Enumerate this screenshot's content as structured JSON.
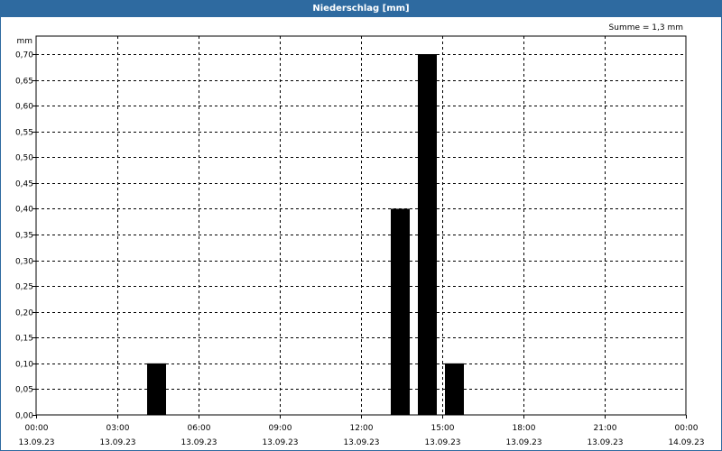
{
  "header": {
    "title": "Niederschlag [mm]"
  },
  "summary": {
    "sum_label": "Summe = 1,3 mm"
  },
  "chart_data": {
    "type": "bar",
    "title": "Niederschlag [mm]",
    "ylabel": "mm",
    "ylim": [
      0,
      0.7
    ],
    "yticks": [
      "0,00",
      "0,05",
      "0,10",
      "0,15",
      "0,20",
      "0,25",
      "0,30",
      "0,35",
      "0,40",
      "0,45",
      "0,50",
      "0,55",
      "0,60",
      "0,65",
      "0,70"
    ],
    "xlim_hours": [
      0,
      24
    ],
    "xticks": [
      {
        "time": "00:00",
        "date": "13.09.23"
      },
      {
        "time": "03:00",
        "date": "13.09.23"
      },
      {
        "time": "06:00",
        "date": "13.09.23"
      },
      {
        "time": "09:00",
        "date": "13.09.23"
      },
      {
        "time": "12:00",
        "date": "13.09.23"
      },
      {
        "time": "15:00",
        "date": "13.09.23"
      },
      {
        "time": "18:00",
        "date": "13.09.23"
      },
      {
        "time": "21:00",
        "date": "13.09.23"
      },
      {
        "time": "00:00",
        "date": "14.09.23"
      }
    ],
    "bars": [
      {
        "hour": 4,
        "value": 0.1
      },
      {
        "hour": 13,
        "value": 0.4
      },
      {
        "hour": 14,
        "value": 0.7
      },
      {
        "hour": 15,
        "value": 0.1
      }
    ],
    "bar_color": "#000000",
    "grid": true,
    "grid_style": "dashed"
  }
}
